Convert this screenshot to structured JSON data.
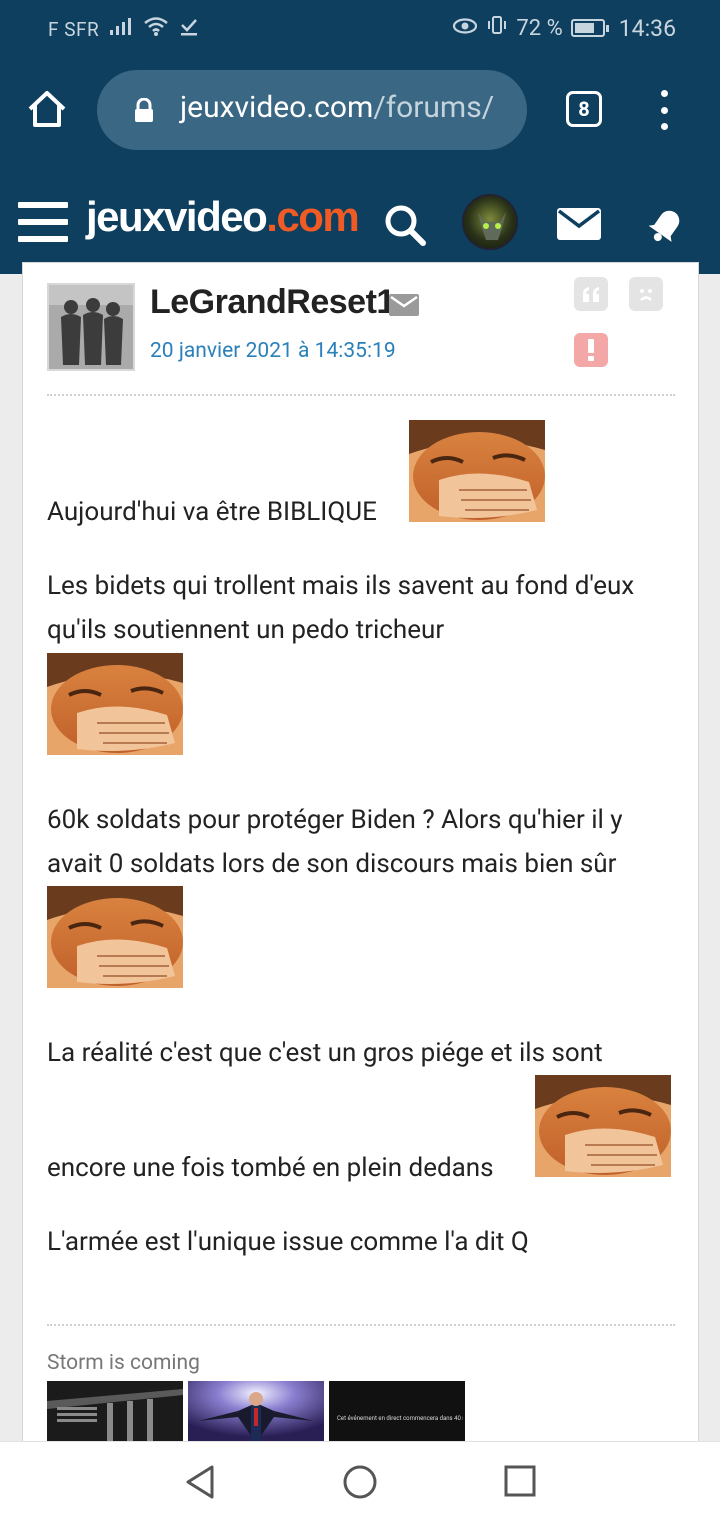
{
  "status_bar": {
    "carrier": "F SFR",
    "battery_percent": "72 %",
    "battery_level": 0.72,
    "time": "14:36"
  },
  "browser": {
    "url_domain": "jeuxvideo.com",
    "url_path": "/forums/",
    "tab_count": "8"
  },
  "site_header": {
    "logo_main": "jeuxvideo",
    "logo_suffix": ".com"
  },
  "post": {
    "author": "LeGrandReset1",
    "date": "20 janvier 2021 à 14:35:19",
    "paragraphs": [
      "Aujourd'hui va être BIBLIQUE",
      "Les bidets qui trollent mais ils savent au fond d'eux qu'ils soutiennent un pedo tricheur",
      "60k soldats pour protéger Biden ? Alors qu'hier il y avait 0 soldats lors de son discours mais bien sûr",
      "La réalité c'est que c'est un gros piége et ils sont",
      "encore une fois tombé en plein dedans",
      "L'armée est l'unique issue comme l'a dit Q"
    ],
    "signature": "Storm is coming",
    "signature_image_3_text": "Cet événement en direct commencera dans 40 minutes."
  },
  "colors": {
    "header_bg": "#0e3f5e",
    "omnibox_bg": "#3a6783",
    "logo_accent": "#f05a24",
    "date_link": "#2a80b9",
    "alert_button": "#f4a7a7"
  }
}
